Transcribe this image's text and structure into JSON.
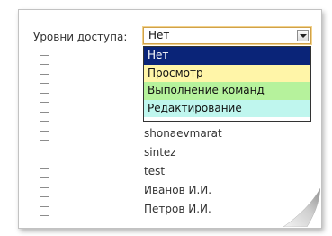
{
  "access": {
    "label": "Уровни доступа:",
    "selected": "Нет"
  },
  "dropdown": {
    "options": [
      {
        "label": "Нет",
        "bg": "#0a2478",
        "fg": "#ffffff"
      },
      {
        "label": "Просмотр",
        "bg": "#fff5a8",
        "fg": "#111111"
      },
      {
        "label": "Выполнение команд",
        "bg": "#b6f29c",
        "fg": "#111111"
      },
      {
        "label": "Редактирование",
        "bg": "#bff6ee",
        "fg": "#111111"
      }
    ]
  },
  "users": [
    {
      "name": ""
    },
    {
      "name": ""
    },
    {
      "name": ""
    },
    {
      "name": ""
    },
    {
      "name": "shonaevmarat"
    },
    {
      "name": "sintez"
    },
    {
      "name": "test"
    },
    {
      "name": "Иванов И.И."
    },
    {
      "name": "Петров И.И."
    }
  ],
  "icons": {
    "select_arrow": "chevron-down-icon",
    "page_curl": "page-curl-icon"
  }
}
